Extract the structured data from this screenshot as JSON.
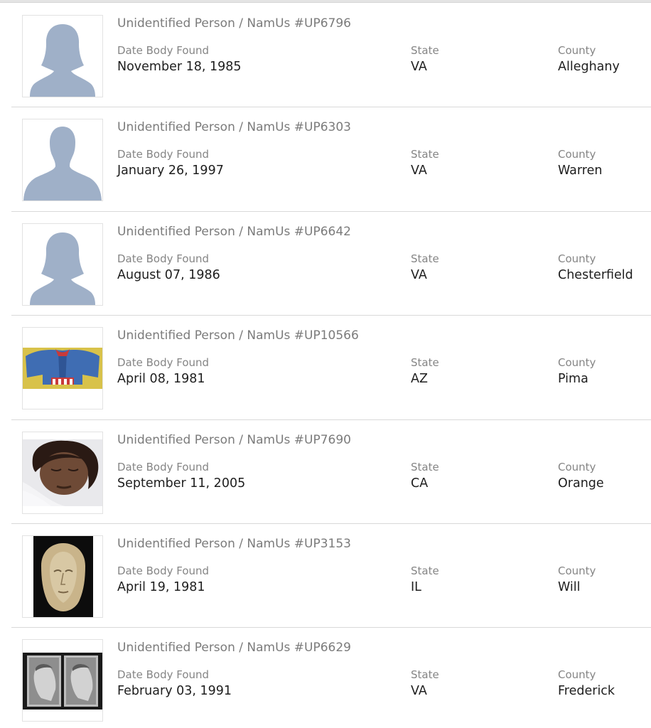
{
  "cases": [
    {
      "title": "Unidentified Person / NamUs #UP6796",
      "date_label": "Date Body Found",
      "date": "November 18, 1985",
      "state_label": "State",
      "state": "VA",
      "county_label": "County",
      "county": "Alleghany",
      "image": "female-silhouette-placeholder"
    },
    {
      "title": "Unidentified Person / NamUs #UP6303",
      "date_label": "Date Body Found",
      "date": "January 26, 1997",
      "state_label": "State",
      "state": "VA",
      "county_label": "County",
      "county": "Warren",
      "image": "male-silhouette-placeholder"
    },
    {
      "title": "Unidentified Person / NamUs #UP6642",
      "date_label": "Date Body Found",
      "date": "August 07, 1986",
      "state_label": "State",
      "state": "VA",
      "county_label": "County",
      "county": "Chesterfield",
      "image": "female-silhouette-placeholder"
    },
    {
      "title": "Unidentified Person / NamUs #UP10566",
      "date_label": "Date Body Found",
      "date": "April 08, 1981",
      "state_label": "State",
      "state": "AZ",
      "county_label": "County",
      "county": "Pima",
      "image": "clothing-photo"
    },
    {
      "title": "Unidentified Person / NamUs #UP7690",
      "date_label": "Date Body Found",
      "date": "September 11, 2005",
      "state_label": "State",
      "state": "CA",
      "county_label": "County",
      "county": "Orange",
      "image": "face-photo"
    },
    {
      "title": "Unidentified Person / NamUs #UP3153",
      "date_label": "Date Body Found",
      "date": "April 19, 1981",
      "state_label": "State",
      "state": "IL",
      "county_label": "County",
      "county": "Will",
      "image": "facial-reconstruction-bust"
    },
    {
      "title": "Unidentified Person / NamUs #UP6629",
      "date_label": "Date Body Found",
      "date": "February 03, 1991",
      "state_label": "State",
      "state": "VA",
      "county_label": "County",
      "county": "Frederick",
      "image": "reconstruction-bust-pair"
    }
  ],
  "colors": {
    "silhouette": "#9fb0c8",
    "title_text": "#7b7b7b",
    "label_text": "#858585",
    "value_text": "#1e1e1e",
    "divider": "#d9d9d9"
  }
}
